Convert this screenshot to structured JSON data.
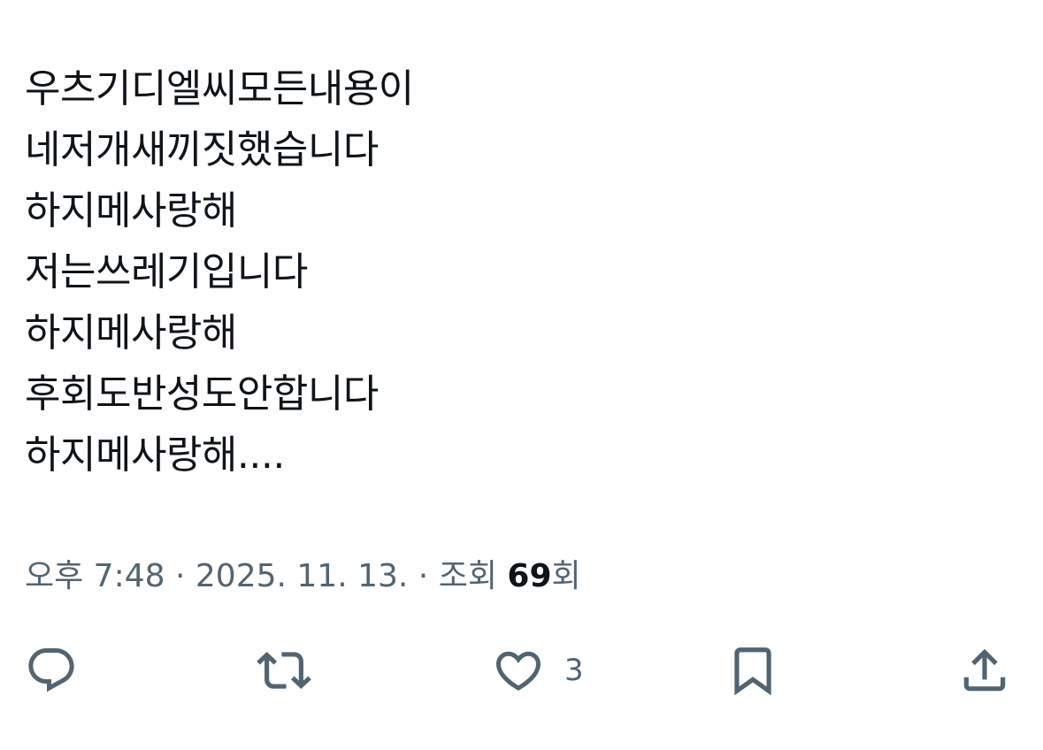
{
  "tweet": {
    "lines": [
      "우츠기디엘씨모든내용이",
      "네저개새끼짓했습니다",
      "하지메사랑해",
      "저는쓰레기입니다",
      "하지메사랑해",
      "후회도반성도안합니다",
      "하지메사랑해...."
    ]
  },
  "meta": {
    "time": "오후 7:48",
    "separator": "·",
    "date": "2025. 11. 13.",
    "views_label": "조회",
    "views_count": "69",
    "views_suffix": "회"
  },
  "actions": {
    "reply": {
      "icon": "reply-icon"
    },
    "repost": {
      "icon": "repost-icon"
    },
    "like": {
      "icon": "heart-icon",
      "count": "3"
    },
    "bookmark": {
      "icon": "bookmark-icon"
    },
    "share": {
      "icon": "share-icon"
    }
  },
  "colors": {
    "text": "#0f1419",
    "secondary": "#536471",
    "background": "#ffffff"
  }
}
